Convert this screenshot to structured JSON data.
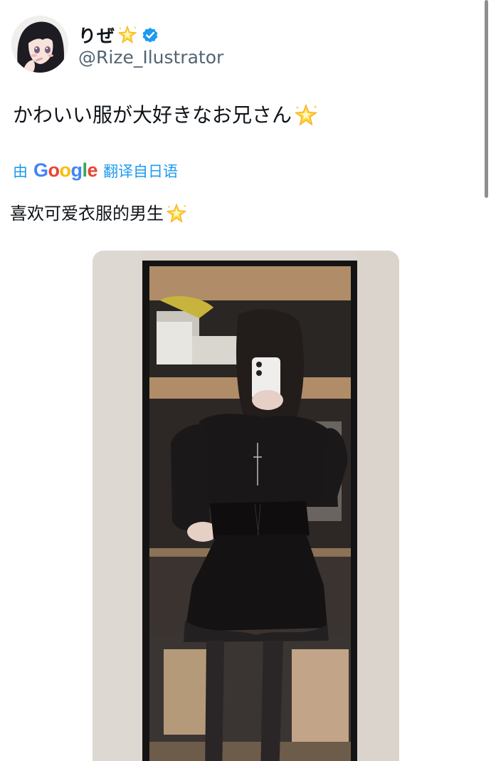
{
  "tweet": {
    "display_name": "りぜ",
    "handle": "@Rize_Ilustrator",
    "verified": true,
    "text": "かわいい服が大好きなお兄さん",
    "translation": {
      "prefix": "由",
      "provider": "Google",
      "suffix": "翻译自日语",
      "text": "喜欢可爱衣服的男生"
    },
    "emoji": "glowing-star"
  },
  "colors": {
    "link_blue": "#1d9bf0",
    "secondary_text": "#536471",
    "verified_blue": "#1d9bf0"
  }
}
